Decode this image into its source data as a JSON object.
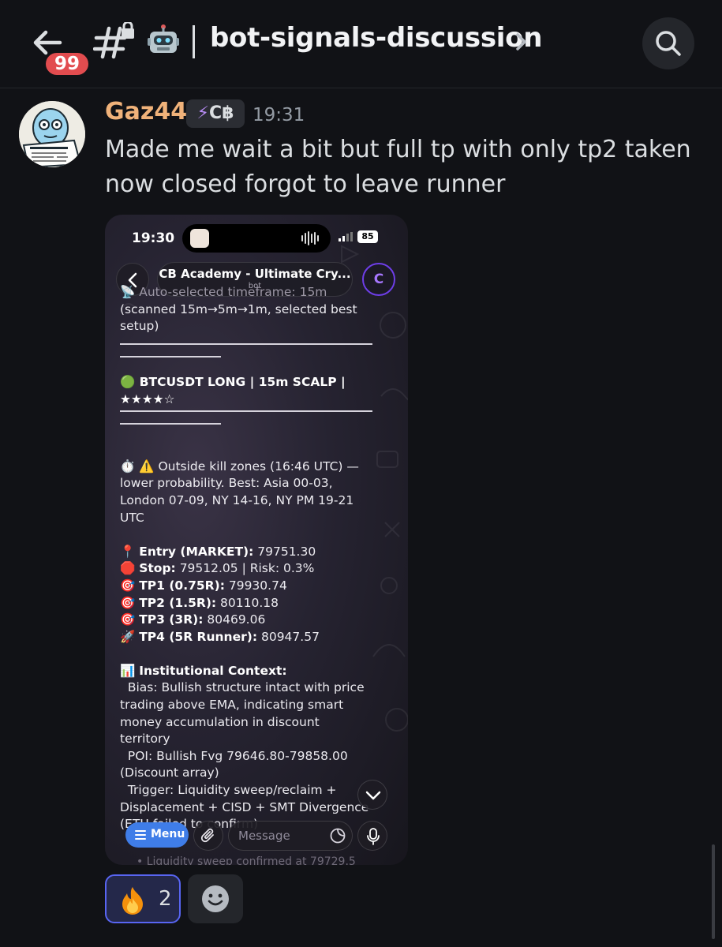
{
  "header": {
    "unread_count": "99",
    "channel_name": "bot-signals-discussion",
    "channel_emoji": "robot-face"
  },
  "message": {
    "author": "Gaz44",
    "role_tag": "C฿",
    "timestamp": "19:31",
    "text": "Made me wait a bit but full tp with only tp2 taken now closed forgot to leave runner"
  },
  "screenshot": {
    "status_time": "19:30",
    "battery": "85",
    "chat_title": "CB Academy - Ultimate Cry...",
    "chat_subtitle": "bot",
    "avatar_letter": "C",
    "signal": {
      "line_timeframe": "📡 Auto-selected timeframe: 15m",
      "line_scanned": "(scanned 15m→5m→1m, selected best setup)",
      "title": "🟢 BTCUSDT LONG | 15m SCALP | ★★★★☆",
      "killzone": "⏱️ ⚠️ Outside kill zones (16:46 UTC) — lower probability. Best: Asia 00-03, London 07-09, NY 14-16, NY PM 19-21 UTC",
      "entry_label": "Entry (MARKET):",
      "entry_value": "79751.30",
      "stop_label": "Stop:",
      "stop_value": "79512.05 | Risk: 0.3%",
      "tp1_label": "TP1 (0.75R):",
      "tp1_value": "79930.74",
      "tp2_label": "TP2 (1.5R):",
      "tp2_value": "80110.18",
      "tp3_label": "TP3 (3R):",
      "tp3_value": "80469.06",
      "tp4_label": "TP4 (5R Runner):",
      "tp4_value": "80947.57",
      "context_title": "Institutional Context:",
      "bias": "  Bias: Bullish structure intact with price trading above EMA, indicating smart money accumulation in discount territory",
      "poi": "  POI: Bullish Fvg 79646.80-79858.00 (Discount array)",
      "trigger": "  Trigger: Liquidity sweep/reclaim + Displacement + CISD + SMT Divergence (ETH failed to confirm)",
      "underlay": "• Liquidity sweep confirmed at 79729.5"
    },
    "menu_label": "Menu",
    "input_placeholder": "Message"
  },
  "reactions": [
    {
      "emoji": "fire",
      "count": "2"
    }
  ]
}
